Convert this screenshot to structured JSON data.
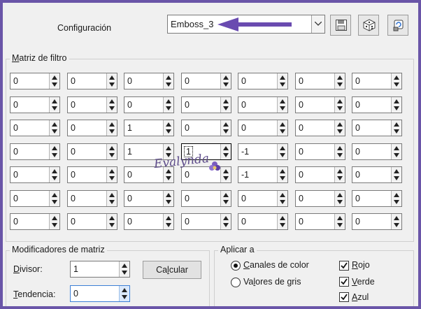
{
  "config": {
    "label": "Configuración",
    "preset_value": "Emboss_3",
    "arrow_color": "#6a4bb0",
    "toolbar_icons": [
      "save-icon",
      "dice-random-icon",
      "reset-defaults-icon"
    ]
  },
  "matrix_group": {
    "title": "Matriz de filtro",
    "rows": [
      [
        "0",
        "0",
        "0",
        "0",
        "0",
        "0",
        "0"
      ],
      [
        "0",
        "0",
        "0",
        "0",
        "0",
        "0",
        "0"
      ],
      [
        "0",
        "0",
        "1",
        "0",
        "0",
        "0",
        "0"
      ],
      [
        "0",
        "0",
        "1",
        "1",
        "-1",
        "0",
        "0"
      ],
      [
        "0",
        "0",
        "0",
        "0",
        "-1",
        "0",
        "0"
      ],
      [
        "0",
        "0",
        "0",
        "0",
        "0",
        "0",
        "0"
      ],
      [
        "0",
        "0",
        "0",
        "0",
        "0",
        "0",
        "0"
      ]
    ]
  },
  "watermark": {
    "text": "Evalynda"
  },
  "modifiers": {
    "title": "Modificadores de matriz",
    "divisor_label": "Divisor:",
    "divisor_value": "1",
    "bias_label": "Tendencia:",
    "bias_value": "0",
    "calc_label": "Calcular"
  },
  "apply": {
    "title": "Aplicar a",
    "radio_color": "Canales de color",
    "radio_gray": "Valores de gris",
    "color_selected": true,
    "check_red": "Rojo",
    "check_green": "Verde",
    "check_blue": "Azul"
  },
  "colors": {
    "frame": "#6a55a8",
    "panel": "#f0f0f0"
  }
}
